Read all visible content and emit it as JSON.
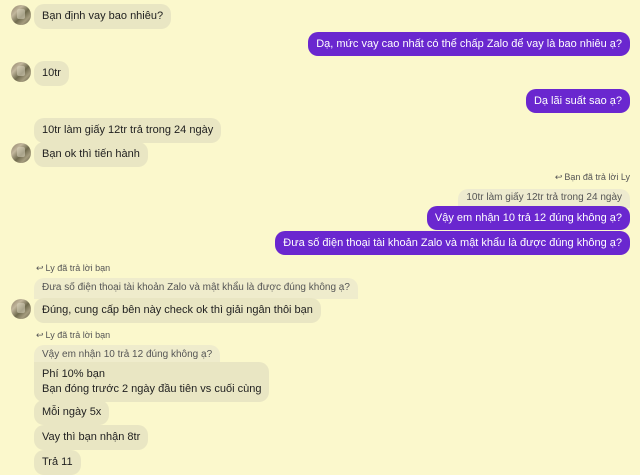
{
  "messages": {
    "m1": "Bạn định vay bao nhiêu?",
    "m2": "Dạ, mức vay cao nhất có thể chấp Zalo để vay là bao nhiêu ạ?",
    "m3": "10tr",
    "m4": "Dạ lãi suất sao ạ?",
    "m5": "10tr làm giấy 12tr trả trong 24 ngày",
    "m6": "Bạn ok thì tiến hành",
    "m7_reply_label": "Bạn đã trả lời Ly",
    "m7_quote": "10tr làm giấy 12tr trả trong 24 ngày",
    "m7": "Vậy em nhận 10 trả 12 đúng không ạ?",
    "m8": "Đưa số điện thoại tài khoản Zalo và mật khẩu là được đúng không ạ?",
    "m9_reply_label": "Ly đã trả lời bạn",
    "m9_quote": "Đưa số điện thoại tài khoản Zalo và mật khẩu là được đúng không ạ?",
    "m9": "Đúng, cung cấp bên này check ok thì giải ngân thôi bạn",
    "m10_reply_label": "Ly đã trả lời bạn",
    "m10_quote": "Vậy em nhận 10 trả 12 đúng không ạ?",
    "m10_line1": "Phí 10% bạn",
    "m10_line2": "Bạn đóng trước 2 ngày đầu tiên vs cuối cùng",
    "m11": "Mỗi ngày 5x",
    "m12": "Vay thì bạn nhận 8tr",
    "m13": "Trả 11"
  },
  "colors": {
    "background": "#fbf8cc",
    "incoming_bubble": "#e9e6c3",
    "outgoing_bubble": "#6a27cf"
  },
  "icons": {
    "reply_arrow": "reply-arrow-icon",
    "avatar": "pixelated-avatar"
  }
}
